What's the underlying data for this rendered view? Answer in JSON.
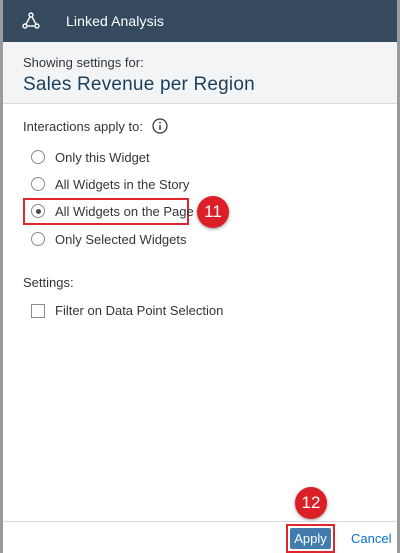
{
  "titlebar": {
    "title": "Linked Analysis",
    "icon": "linked-analysis-icon"
  },
  "header": {
    "subtitle": "Showing settings for:",
    "title": "Sales Revenue per Region"
  },
  "interactions": {
    "label": "Interactions apply to:",
    "info_icon": "info-icon",
    "options": [
      {
        "label": "Only this Widget",
        "selected": false
      },
      {
        "label": "All Widgets in the Story",
        "selected": false
      },
      {
        "label": "All Widgets on the Page",
        "selected": true
      },
      {
        "label": "Only Selected Widgets",
        "selected": false
      }
    ]
  },
  "settings": {
    "label": "Settings:",
    "filter_checkbox": {
      "label": "Filter on Data Point Selection",
      "checked": false
    }
  },
  "annotations": {
    "step_11": "11",
    "step_12": "12"
  },
  "footer": {
    "apply_label": "Apply",
    "cancel_label": "Cancel"
  },
  "colors": {
    "titlebar_bg": "#354a5f",
    "header_title": "#1c3f5c",
    "apply_bg": "#427cac",
    "cancel_text": "#0a6ed1",
    "highlight": "#e2262d"
  }
}
